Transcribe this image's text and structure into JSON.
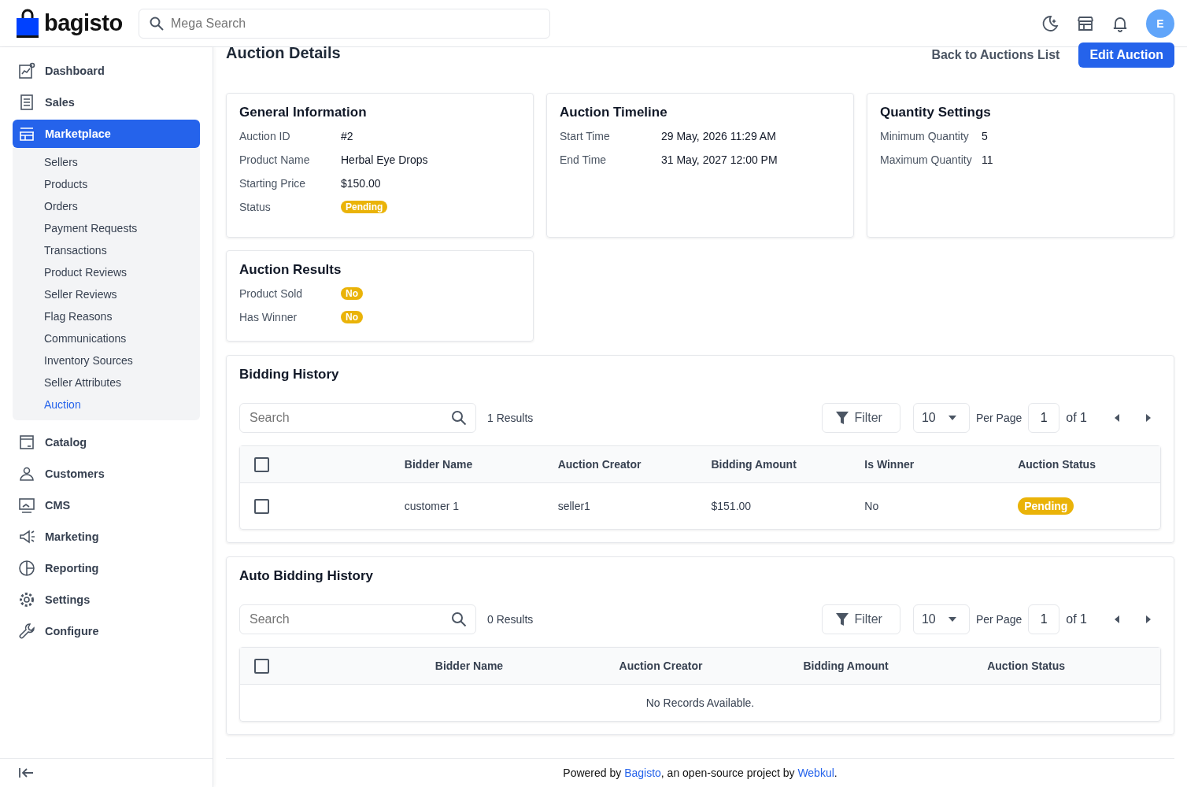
{
  "header": {
    "logo": "bagisto",
    "search": {
      "placeholder": "Mega Search"
    },
    "avatar": "E"
  },
  "sidebar": {
    "items": [
      {
        "label": "Dashboard",
        "selected": false
      },
      {
        "label": "Sales",
        "selected": false
      },
      {
        "label": "Marketplace",
        "selected": true,
        "children": [
          {
            "label": "Sellers",
            "selected": false
          },
          {
            "label": "Products",
            "selected": false
          },
          {
            "label": "Orders",
            "selected": false
          },
          {
            "label": "Payment Requests",
            "selected": false
          },
          {
            "label": "Transactions",
            "selected": false
          },
          {
            "label": "Product Reviews",
            "selected": false
          },
          {
            "label": "Seller Reviews",
            "selected": false
          },
          {
            "label": "Flag Reasons",
            "selected": false
          },
          {
            "label": "Communications",
            "selected": false
          },
          {
            "label": "Inventory Sources",
            "selected": false
          },
          {
            "label": "Seller Attributes",
            "selected": false
          },
          {
            "label": "Auction",
            "selected": true
          }
        ]
      },
      {
        "label": "Catalog",
        "selected": false
      },
      {
        "label": "Customers",
        "selected": false
      },
      {
        "label": "CMS",
        "selected": false
      },
      {
        "label": "Marketing",
        "selected": false
      },
      {
        "label": "Reporting",
        "selected": false
      },
      {
        "label": "Settings",
        "selected": false
      },
      {
        "label": "Configure",
        "selected": false
      }
    ]
  },
  "page": {
    "title": "Auction Details",
    "back_link": "Back to Auctions List",
    "edit_button": "Edit Auction"
  },
  "cards": [
    {
      "title": "General Information",
      "rows": [
        {
          "label": "Auction ID",
          "value": "#2",
          "kind": "text"
        },
        {
          "label": "Product Name",
          "value": "Herbal Eye Drops",
          "kind": "text"
        },
        {
          "label": "Starting Price",
          "value": "$150.00",
          "kind": "text"
        },
        {
          "label": "Status",
          "value": "Pending",
          "kind": "badge"
        }
      ]
    },
    {
      "title": "Auction Timeline",
      "rows": [
        {
          "label": "Start Time",
          "value": "29 May, 2026 11:29 AM",
          "kind": "text"
        },
        {
          "label": "End Time",
          "value": "31 May, 2027 12:00 PM",
          "kind": "text"
        }
      ]
    },
    {
      "title": "Quantity Settings",
      "rows": [
        {
          "label": "Minimum Quantity",
          "value": "5",
          "kind": "text"
        },
        {
          "label": "Maximum Quantity",
          "value": "11",
          "kind": "text"
        }
      ]
    },
    {
      "title": "Auction Results",
      "rows": [
        {
          "label": "Product Sold",
          "value": "No",
          "kind": "badge"
        },
        {
          "label": "Has Winner",
          "value": "No",
          "kind": "badge"
        }
      ]
    }
  ],
  "grids": [
    {
      "title": "Bidding History",
      "search": {
        "placeholder": "Search"
      },
      "results": "1 Results",
      "filter": "Filter",
      "per_page_value": "10",
      "per_page_label": "Per Page",
      "page": "1",
      "of": "of 1",
      "header_checked": false,
      "columns": [
        "Bidder Name",
        "Auction Creator",
        "Bidding Amount",
        "Is Winner",
        "Auction Status"
      ],
      "rows": [
        {
          "checked": false,
          "cells": [
            {
              "text": "customer 1",
              "kind": "text"
            },
            {
              "text": "seller1",
              "kind": "text"
            },
            {
              "text": "$151.00",
              "kind": "text"
            },
            {
              "text": "No",
              "kind": "text"
            },
            {
              "text": "Pending",
              "kind": "badge"
            }
          ]
        }
      ]
    },
    {
      "title": "Auto Bidding History",
      "search": {
        "placeholder": "Search"
      },
      "results": "0 Results",
      "filter": "Filter",
      "per_page_value": "10",
      "per_page_label": "Per Page",
      "page": "1",
      "of": "of 1",
      "header_checked": false,
      "columns": [
        "Bidder Name",
        "Auction Creator",
        "Bidding Amount",
        "Auction Status"
      ],
      "empty": "No Records Available."
    }
  ],
  "footer": {
    "parts": [
      {
        "text": "Powered by ",
        "kind": "text"
      },
      {
        "text": "Bagisto",
        "kind": "link"
      },
      {
        "text": ", an open-source project by ",
        "kind": "text"
      },
      {
        "text": "Webkul",
        "kind": "link"
      },
      {
        "text": ".",
        "kind": "text"
      }
    ]
  }
}
